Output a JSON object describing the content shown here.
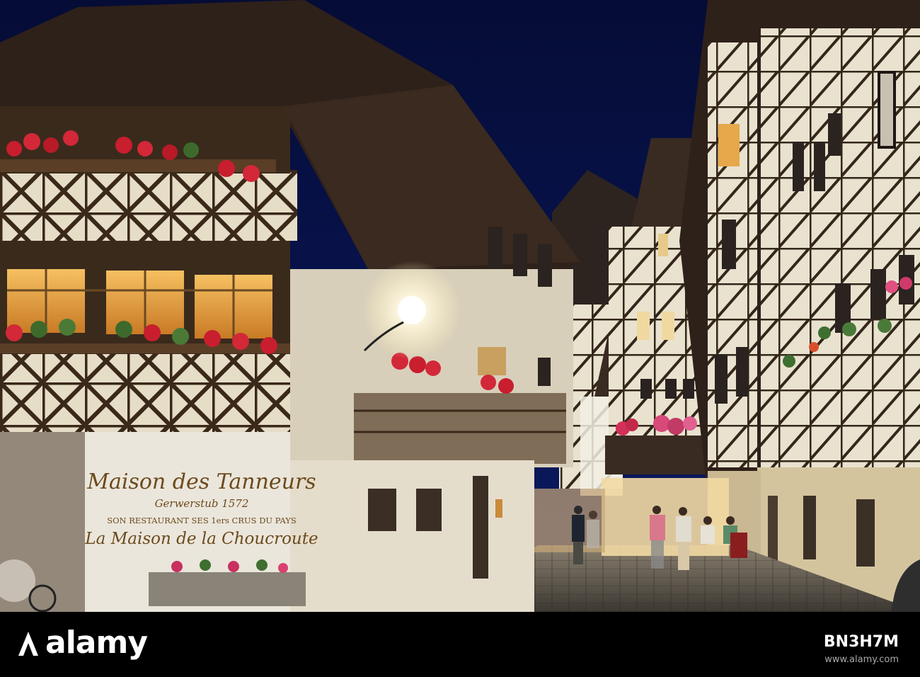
{
  "scene": {
    "description_colors": {
      "sky": "#07124a",
      "timber": "#3b2a1c",
      "plaster": "#e8e0cc",
      "window_glow": "#f3b04a",
      "cobble": "#5a554c"
    }
  },
  "sign": {
    "line1": "Maison des Tanneurs",
    "line2": "Gerwerstub 1572",
    "line3": "SON RESTAURANT SES 1ers CRUS DU PAYS",
    "line4": "La Maison de la Choucroute"
  },
  "watermark": {
    "logo": "alamy",
    "image_id": "BN3H7M",
    "site": "www.alamy.com"
  }
}
